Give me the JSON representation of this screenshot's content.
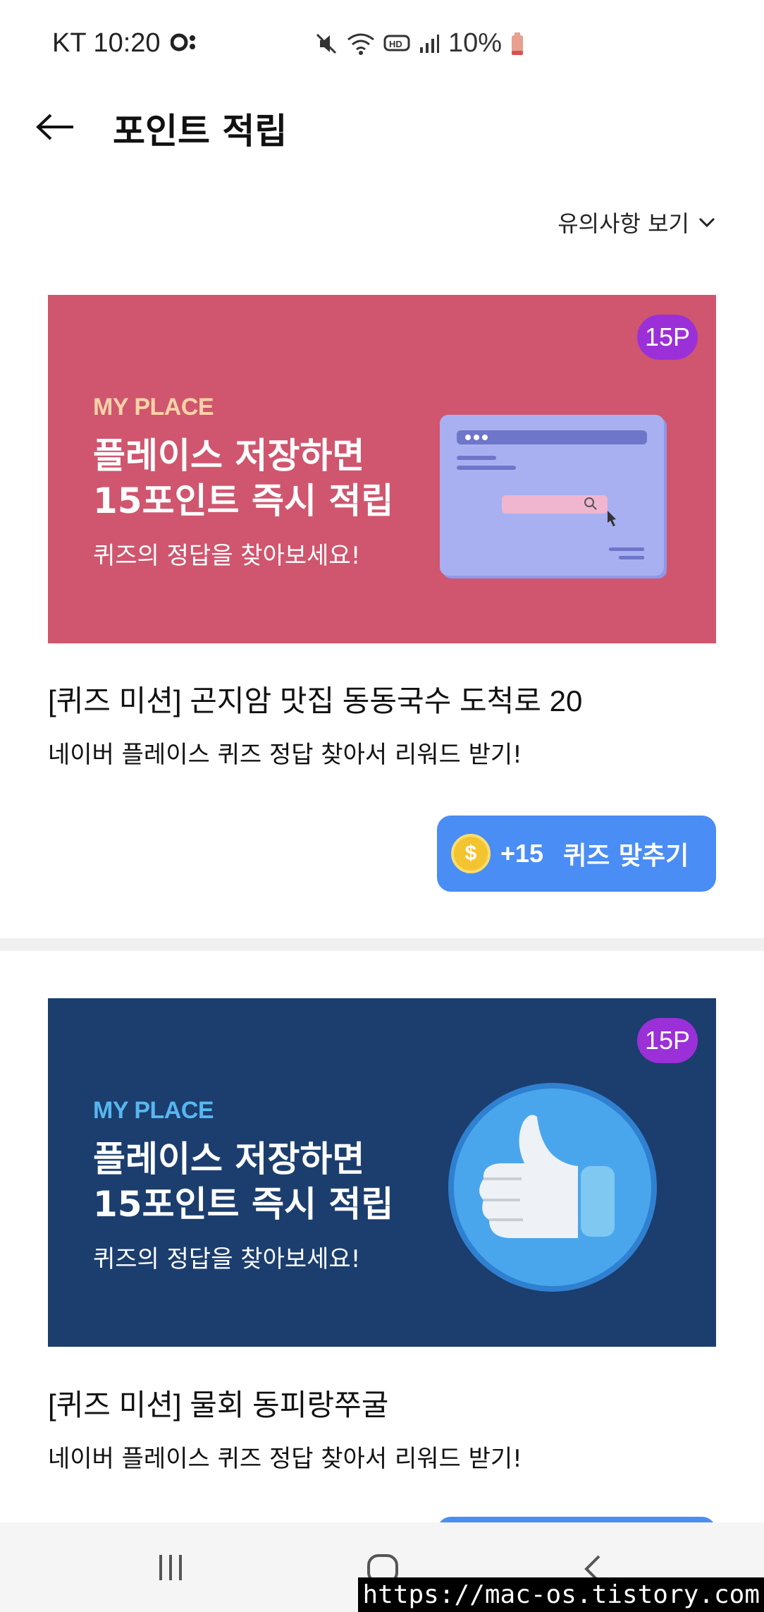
{
  "status_bar": {
    "carrier_time": "KT 10:20",
    "battery": "10%"
  },
  "header": {
    "title": "포인트 적립"
  },
  "notice_toggle": {
    "label": "유의사항 보기"
  },
  "cards": [
    {
      "badge": "15P",
      "eyebrow": "MY PLACE",
      "headline_1": "플레이스 저장하면",
      "headline_2": "15포인트 즉시 적립",
      "subtitle": "퀴즈의 정답을 찾아보세요!",
      "title": "[퀴즈 미션] 곤지암 맛집 동동국수 도척로 20",
      "description": "네이버 플레이스 퀴즈 정답 찾아서 리워드 받기!",
      "button_points": "+15",
      "button_label": "퀴즈 맞추기",
      "coin_symbol": "$"
    },
    {
      "badge": "15P",
      "eyebrow": "MY PLACE",
      "headline_1": "플레이스 저장하면",
      "headline_2": "15포인트 즉시 적립",
      "subtitle": "퀴즈의 정답을 찾아보세요!",
      "title": "[퀴즈 미션] 물회 동피랑쭈굴",
      "description": "네이버 플레이스 퀴즈 정답 찾아서 리워드 받기!"
    }
  ],
  "colors": {
    "banner_pink": "#cf566e",
    "banner_navy": "#1b3e6e",
    "badge_purple": "#9b30d9",
    "button_blue": "#4a8df4"
  },
  "watermark": "https://mac-os.tistory.com"
}
